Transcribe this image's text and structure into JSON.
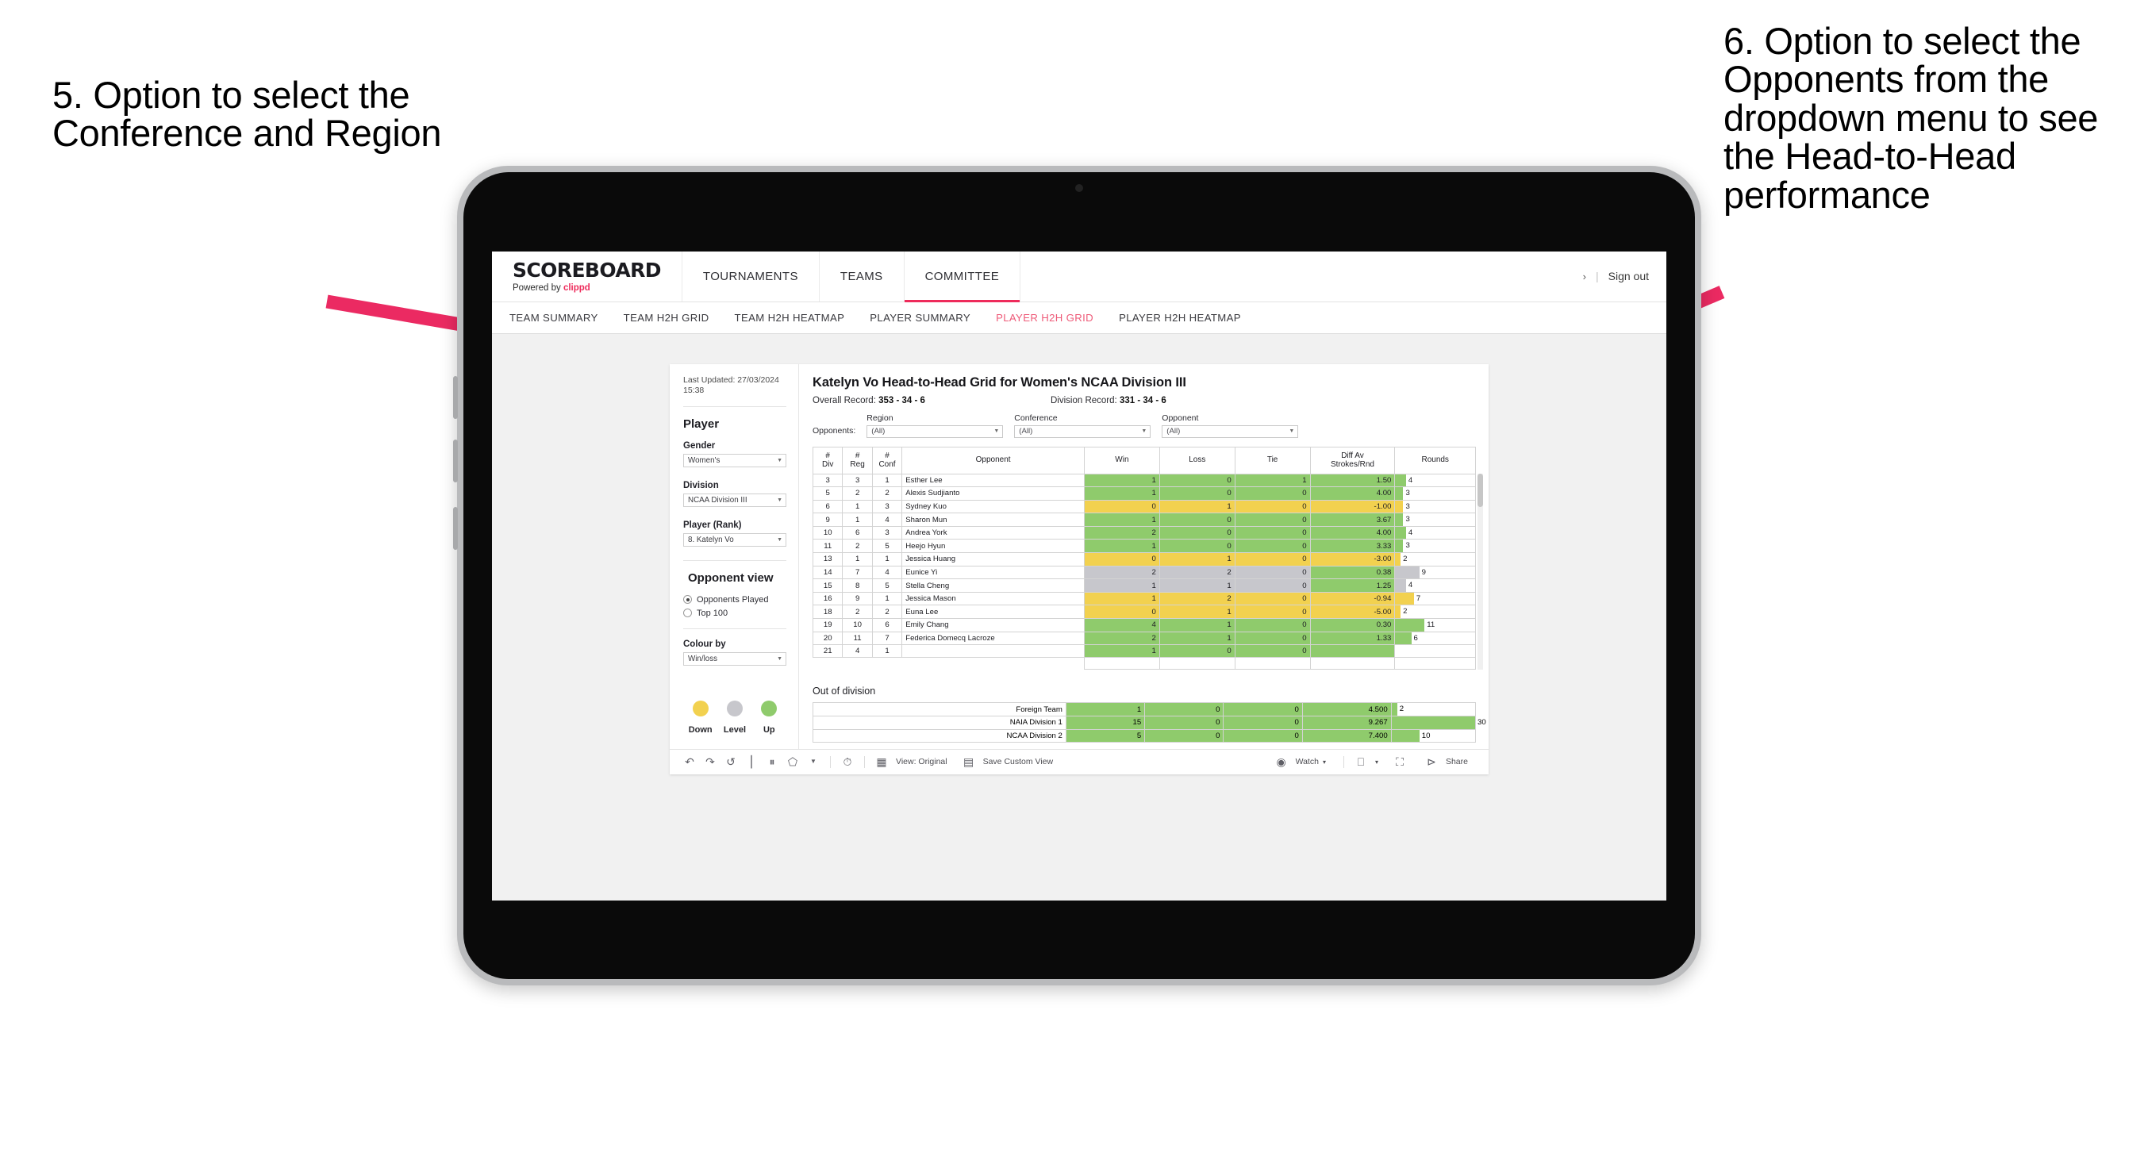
{
  "annotations": {
    "left": "5. Option to select the Conference and Region",
    "right": "6. Option to select the Opponents from the dropdown menu to see the Head-to-Head performance",
    "arrow_color": "#eb2a62"
  },
  "app": {
    "brand": {
      "title": "SCOREBOARD",
      "powered_prefix": "Powered by ",
      "powered_brand": "clippd"
    },
    "nav": [
      {
        "label": "TOURNAMENTS",
        "active": false
      },
      {
        "label": "TEAMS",
        "active": false
      },
      {
        "label": "COMMITTEE",
        "active": true
      }
    ],
    "account": {
      "chevron": "›",
      "separator": "|",
      "sign_out": "Sign out"
    },
    "subnav": [
      {
        "label": "TEAM SUMMARY",
        "active": false
      },
      {
        "label": "TEAM H2H GRID",
        "active": false
      },
      {
        "label": "TEAM H2H HEATMAP",
        "active": false
      },
      {
        "label": "PLAYER SUMMARY",
        "active": false
      },
      {
        "label": "PLAYER H2H GRID",
        "active": true
      },
      {
        "label": "PLAYER H2H HEATMAP",
        "active": false
      }
    ]
  },
  "sidebar": {
    "last_updated": "Last Updated: 27/03/2024 15:38",
    "player_heading": "Player",
    "gender": {
      "label": "Gender",
      "value": "Women's"
    },
    "division": {
      "label": "Division",
      "value": "NCAA Division III"
    },
    "player_rank": {
      "label": "Player (Rank)",
      "value": "8. Katelyn Vo"
    },
    "opponent_view": {
      "heading": "Opponent view",
      "options": [
        {
          "label": "Opponents Played",
          "selected": true
        },
        {
          "label": "Top 100",
          "selected": false
        }
      ]
    },
    "colour_by": {
      "label": "Colour by",
      "value": "Win/loss"
    },
    "legend": [
      {
        "label": "Down",
        "color": "#f2d14f"
      },
      {
        "label": "Level",
        "color": "#c7c7cc"
      },
      {
        "label": "Up",
        "color": "#8fcb6c"
      }
    ]
  },
  "view": {
    "title": "Katelyn Vo Head-to-Head Grid for Women's NCAA Division III",
    "overall_record_label": "Overall Record:",
    "overall_record": "353 -  34 - 6",
    "division_record_label": "Division Record:",
    "division_record": "331 -  34 - 6",
    "opponents_label": "Opponents:",
    "filters": [
      {
        "label": "Region",
        "value": "(All)"
      },
      {
        "label": "Conference",
        "value": "(All)"
      },
      {
        "label": "Opponent",
        "value": "(All)"
      }
    ]
  },
  "table": {
    "headers": [
      "#\nDiv",
      "#\nReg",
      "#\nConf",
      "Opponent",
      "Win",
      "Loss",
      "Tie",
      "Diff Av\nStrokes/Rnd",
      "Rounds"
    ],
    "max_rounds": 30,
    "rows": [
      {
        "div": "3",
        "reg": "3",
        "conf": "1",
        "opponent": "Esther Lee",
        "win": "1",
        "loss": "0",
        "tie": "1",
        "diff": "1.50",
        "rounds": "4",
        "color": "#8fcb6c"
      },
      {
        "div": "5",
        "reg": "2",
        "conf": "2",
        "opponent": "Alexis Sudjianto",
        "win": "1",
        "loss": "0",
        "tie": "0",
        "diff": "4.00",
        "rounds": "3",
        "color": "#8fcb6c"
      },
      {
        "div": "6",
        "reg": "1",
        "conf": "3",
        "opponent": "Sydney Kuo",
        "win": "0",
        "loss": "1",
        "tie": "0",
        "diff": "-1.00",
        "rounds": "3",
        "color": "#f2d14f"
      },
      {
        "div": "9",
        "reg": "1",
        "conf": "4",
        "opponent": "Sharon Mun",
        "win": "1",
        "loss": "0",
        "tie": "0",
        "diff": "3.67",
        "rounds": "3",
        "color": "#8fcb6c"
      },
      {
        "div": "10",
        "reg": "6",
        "conf": "3",
        "opponent": "Andrea York",
        "win": "2",
        "loss": "0",
        "tie": "0",
        "diff": "4.00",
        "rounds": "4",
        "color": "#8fcb6c"
      },
      {
        "div": "11",
        "reg": "2",
        "conf": "5",
        "opponent": "Heejo Hyun",
        "win": "1",
        "loss": "0",
        "tie": "0",
        "diff": "3.33",
        "rounds": "3",
        "color": "#8fcb6c"
      },
      {
        "div": "13",
        "reg": "1",
        "conf": "1",
        "opponent": "Jessica Huang",
        "win": "0",
        "loss": "1",
        "tie": "0",
        "diff": "-3.00",
        "rounds": "2",
        "color": "#f2d14f"
      },
      {
        "div": "14",
        "reg": "7",
        "conf": "4",
        "opponent": "Eunice Yi",
        "win": "2",
        "loss": "2",
        "tie": "0",
        "diff": "0.38",
        "rounds": "9",
        "color": "#c7c7cc",
        "diff_color": "#8fcb6c"
      },
      {
        "div": "15",
        "reg": "8",
        "conf": "5",
        "opponent": "Stella Cheng",
        "win": "1",
        "loss": "1",
        "tie": "0",
        "diff": "1.25",
        "rounds": "4",
        "color": "#c7c7cc",
        "diff_color": "#8fcb6c"
      },
      {
        "div": "16",
        "reg": "9",
        "conf": "1",
        "opponent": "Jessica Mason",
        "win": "1",
        "loss": "2",
        "tie": "0",
        "diff": "-0.94",
        "rounds": "7",
        "color": "#f2d14f"
      },
      {
        "div": "18",
        "reg": "2",
        "conf": "2",
        "opponent": "Euna Lee",
        "win": "0",
        "loss": "1",
        "tie": "0",
        "diff": "-5.00",
        "rounds": "2",
        "color": "#f2d14f"
      },
      {
        "div": "19",
        "reg": "10",
        "conf": "6",
        "opponent": "Emily Chang",
        "win": "4",
        "loss": "1",
        "tie": "0",
        "diff": "0.30",
        "rounds": "11",
        "color": "#8fcb6c"
      },
      {
        "div": "20",
        "reg": "11",
        "conf": "7",
        "opponent": "Federica Domecq Lacroze",
        "win": "2",
        "loss": "1",
        "tie": "0",
        "diff": "1.33",
        "rounds": "6",
        "color": "#8fcb6c"
      }
    ]
  },
  "out_of_division": {
    "heading": "Out of division",
    "max_rounds": 30,
    "rows": [
      {
        "name": "Foreign Team",
        "win": "1",
        "loss": "0",
        "tie": "0",
        "diff": "4.500",
        "rounds": "2",
        "color": "#8fcb6c"
      },
      {
        "name": "NAIA Division 1",
        "win": "15",
        "loss": "0",
        "tie": "0",
        "diff": "9.267",
        "rounds": "30",
        "color": "#8fcb6c"
      },
      {
        "name": "NCAA Division 2",
        "win": "5",
        "loss": "0",
        "tie": "0",
        "diff": "7.400",
        "rounds": "10",
        "color": "#8fcb6c"
      }
    ]
  },
  "toolbar": {
    "view_original": "View: Original",
    "save_custom_view": "Save Custom View",
    "watch": "Watch",
    "share": "Share",
    "caret": "▾"
  }
}
